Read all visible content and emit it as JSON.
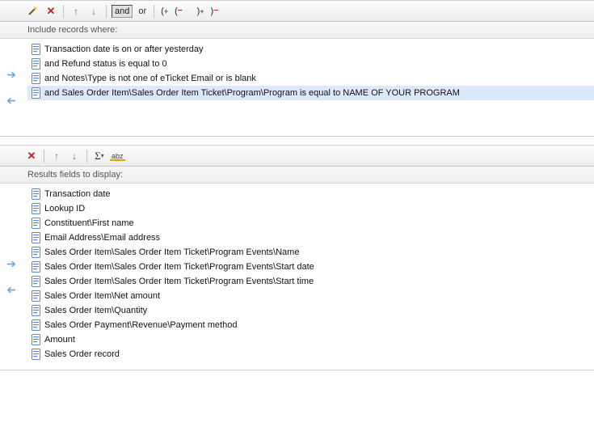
{
  "filter": {
    "header": "Include records where:",
    "logic": {
      "and": "and",
      "or": "or"
    },
    "rows": [
      {
        "text": "Transaction date is on or after yesterday",
        "selected": false
      },
      {
        "text": "and Refund status is equal to 0",
        "selected": false
      },
      {
        "text": "and Notes\\Type is not one of eTicket Email or is blank",
        "selected": false
      },
      {
        "text": "and Sales Order Item\\Sales Order Item Ticket\\Program\\Program is equal to NAME OF YOUR PROGRAM",
        "selected": true
      }
    ]
  },
  "results": {
    "header": "Results fields to display:",
    "rows": [
      "Transaction date",
      "Lookup ID",
      "Constituent\\First name",
      "Email Address\\Email address",
      "Sales Order Item\\Sales Order Item Ticket\\Program Events\\Name",
      "Sales Order Item\\Sales Order Item Ticket\\Program Events\\Start date",
      "Sales Order Item\\Sales Order Item Ticket\\Program Events\\Start time",
      "Sales Order Item\\Net amount",
      "Sales Order Item\\Quantity",
      "Sales Order Payment\\Revenue\\Payment method",
      "Amount",
      "Sales Order record"
    ]
  }
}
